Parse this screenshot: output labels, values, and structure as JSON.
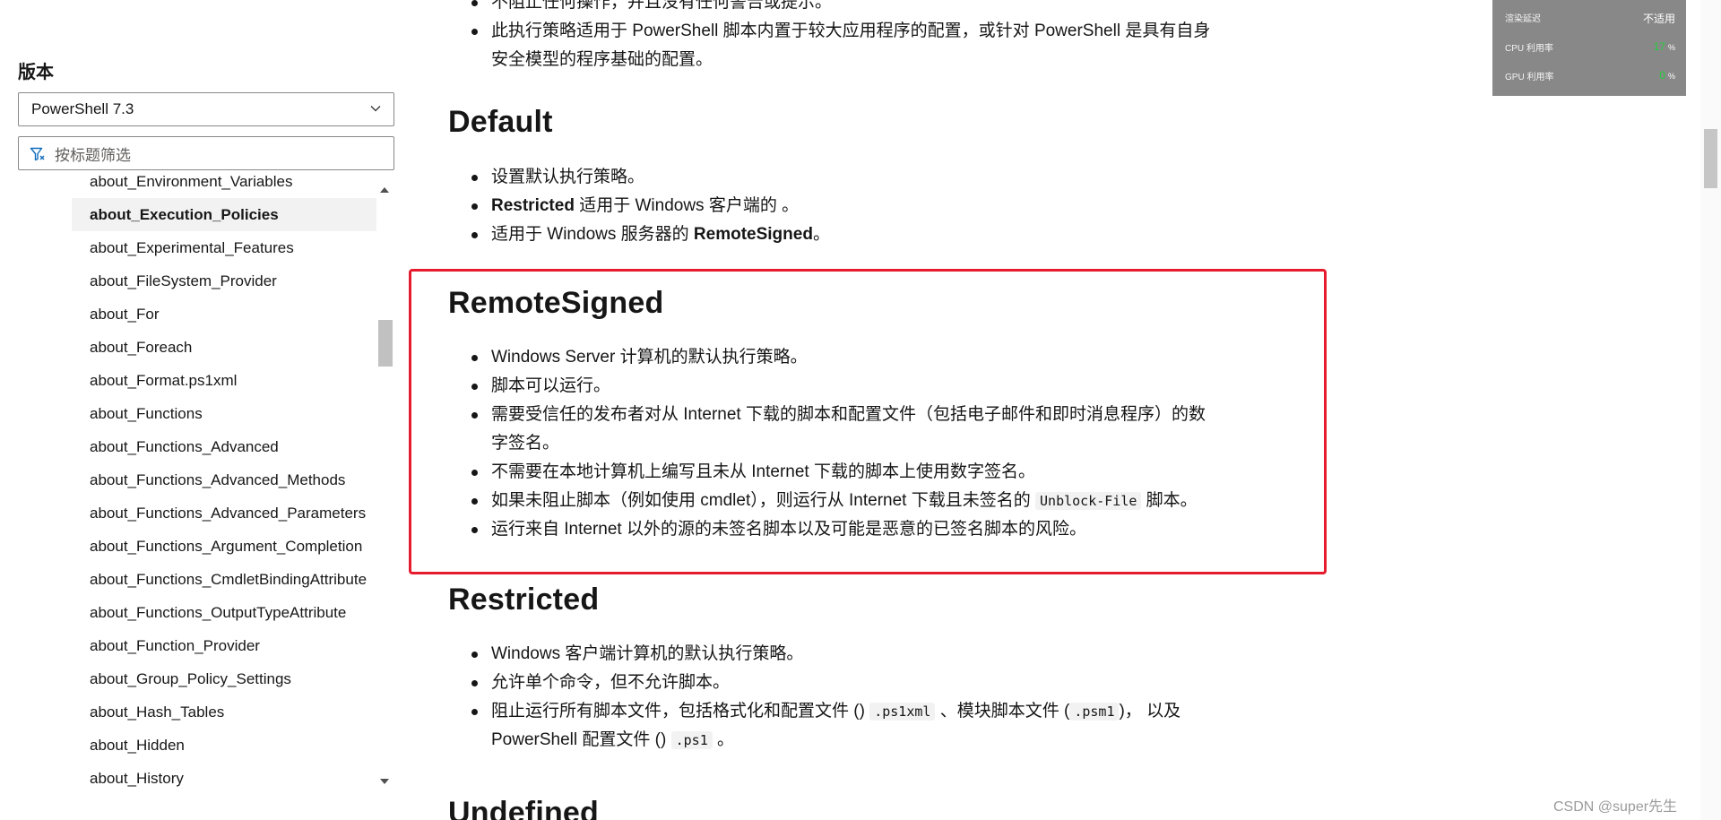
{
  "sidebar": {
    "version_heading": "版本",
    "version_select": "PowerShell 7.3",
    "filter_placeholder": "按标题筛选",
    "toc_items": [
      "about_Environment_Variables",
      "about_Execution_Policies",
      "about_Experimental_Features",
      "about_FileSystem_Provider",
      "about_For",
      "about_Foreach",
      "about_Format.ps1xml",
      "about_Functions",
      "about_Functions_Advanced",
      "about_Functions_Advanced_Methods",
      "about_Functions_Advanced_Parameters",
      "about_Functions_Argument_Completion",
      "about_Functions_CmdletBindingAttribute",
      "about_Functions_OutputTypeAttribute",
      "about_Function_Provider",
      "about_Group_Policy_Settings",
      "about_Hash_Tables",
      "about_Hidden",
      "about_History"
    ],
    "active_item": "about_Execution_Policies"
  },
  "article": {
    "top_partial": "不阻止任何操作，并且没有任何警告或提示。",
    "top_bullet_1": "此执行策略适用于 PowerShell 脚本内置于较大应用程序的配置，或针对 PowerShell 是具有自身",
    "top_bullet_1_cont": "安全模型的程序基础的配置。",
    "default": {
      "heading": "Default",
      "b1": "设置默认执行策略。",
      "b2_bold": "Restricted",
      "b2_rest": " 适用于 Windows 客户端的 。",
      "b3_pre": "适用于 Windows 服务器的 ",
      "b3_bold": "RemoteSigned",
      "b3_post": "。"
    },
    "remotesigned": {
      "heading": "RemoteSigned",
      "b1": "Windows Server 计算机的默认执行策略。",
      "b2": "脚本可以运行。",
      "b3": "需要受信任的发布者对从 Internet 下载的脚本和配置文件（包括电子邮件和即时消息程序）的数",
      "b3_cont": "字签名。",
      "b4": "不需要在本地计算机上编写且未从 Internet 下载的脚本上使用数字签名。",
      "b5_pre": "如果未阻止脚本（例如使用 cmdlet），则运行从 Internet 下载且未签名的 ",
      "b5_code": "Unblock-File",
      "b5_post": " 脚本。",
      "b6": "运行来自 Internet 以外的源的未签名脚本以及可能是恶意的已签名脚本的风险。"
    },
    "restricted": {
      "heading": "Restricted",
      "b1": "Windows 客户端计算机的默认执行策略。",
      "b2": "允许单个命令，但不允许脚本。",
      "b3_pre": "阻止运行所有脚本文件，包括格式化和配置文件 () ",
      "b3_code1": ".ps1xml",
      "b3_mid": " 、模块脚本文件 (",
      "b3_code2": ".psm1",
      "b3_post": ")， 以及",
      "b3_cont_pre": "PowerShell 配置文件 () ",
      "b3_code3": ".ps1",
      "b3_cont_post": " 。"
    },
    "undefined_heading": "Undefined"
  },
  "perf_overlay": {
    "render_latency_label": "渲染延迟",
    "render_latency_value": "不适用",
    "cpu_label": "CPU 利用率",
    "cpu_value": "17",
    "gpu_label": "GPU 利用率",
    "gpu_value": "0",
    "unit": "%"
  },
  "watermark": "CSDN @super先生",
  "colors": {
    "highlight_border": "#e61b2e",
    "perf_bg": "#888888",
    "perf_green": "#22d13a"
  }
}
